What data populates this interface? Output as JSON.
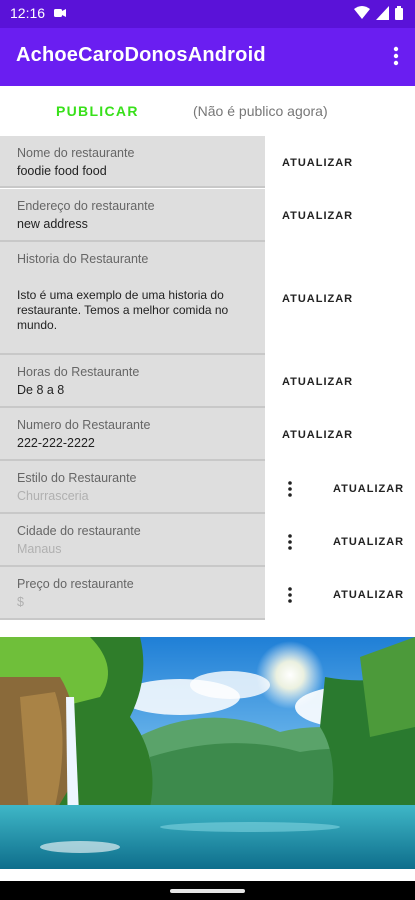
{
  "status_bar": {
    "time": "12:16"
  },
  "app_bar": {
    "title": "AchoeCaroDonosAndroid"
  },
  "publish": {
    "button_label": "PUBLICAR",
    "status_text": "(Não é publico agora)"
  },
  "fields": {
    "name": {
      "label": "Nome do restaurante",
      "value": "foodie food food",
      "action": "ATUALIZAR"
    },
    "address": {
      "label": "Endereço do restaurante",
      "value": "new address",
      "action": "ATUALIZAR"
    },
    "story": {
      "label": "Historia do Restaurante",
      "value": "Isto é uma exemplo de uma historia do restaurante. Temos a melhor comida no mundo.",
      "action": "ATUALIZAR"
    },
    "hours": {
      "label": "Horas do Restaurante",
      "value": "De 8 a 8",
      "action": "ATUALIZAR"
    },
    "phone": {
      "label": "Numero do Restaurante",
      "value": "222-222-2222",
      "action": "ATUALIZAR"
    },
    "style": {
      "label": "Estilo do Restaurante",
      "placeholder": "Churrasceria",
      "action": "ATUALIZAR"
    },
    "city": {
      "label": "Cidade do restaurante",
      "placeholder": "Manaus",
      "action": "ATUALIZAR"
    },
    "price": {
      "label": "Preço do restaurante",
      "placeholder": "$",
      "action": "ATUALIZAR"
    }
  },
  "colors": {
    "status_bar": "#5a12d8",
    "app_bar": "#6a1ef1",
    "publish_green": "#38e01a",
    "field_bg": "#dedede"
  },
  "icons": {
    "notification": "notification-icon",
    "wifi": "wifi-icon",
    "signal": "signal-icon",
    "battery": "battery-icon",
    "overflow": "more-vert-icon"
  },
  "banner": {
    "image": "waterfall-landscape"
  }
}
